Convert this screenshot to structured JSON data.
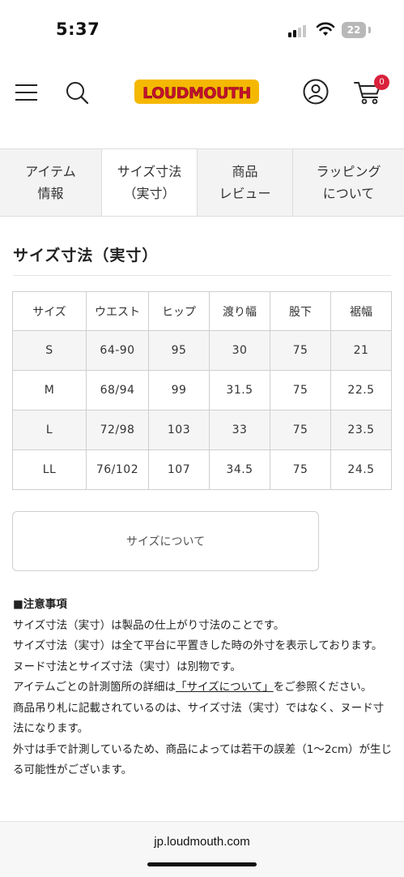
{
  "status_bar": {
    "time": "5:37",
    "battery": "22"
  },
  "header": {
    "logo_text": "LOUDMOUTH",
    "cart_count": "0"
  },
  "tabs": [
    {
      "label": "アイテム\n情報",
      "active": false
    },
    {
      "label": "サイズ寸法\n（実寸）",
      "active": true
    },
    {
      "label": "商品\nレビュー",
      "active": false
    },
    {
      "label": "ラッピング\nについて",
      "active": false
    }
  ],
  "section_title": "サイズ寸法（実寸）",
  "size_table": {
    "headers": [
      "サイズ",
      "ウエスト",
      "ヒップ",
      "渡り幅",
      "股下",
      "裾幅"
    ],
    "rows": [
      [
        "S",
        "64-90",
        "95",
        "30",
        "75",
        "21"
      ],
      [
        "M",
        "68/94",
        "99",
        "31.5",
        "75",
        "22.5"
      ],
      [
        "L",
        "72/98",
        "103",
        "33",
        "75",
        "23.5"
      ],
      [
        "LL",
        "76/102",
        "107",
        "34.5",
        "75",
        "24.5"
      ]
    ]
  },
  "about_size_button": "サイズについて",
  "notes": {
    "heading": "■注意事項",
    "line1": "サイズ寸法（実寸）は製品の仕上がり寸法のことです。",
    "line2": "サイズ寸法（実寸）は全て平台に平置きした時の外寸を表示しております。",
    "line3": "ヌード寸法とサイズ寸法（実寸）は別物です。",
    "line4_pre": "アイテムごとの計測箇所の詳細は",
    "line4_link": "「サイズについて」",
    "line4_post": "をご参照ください。",
    "line5": "商品吊り札に記載されているのは、サイズ寸法（実寸）ではなく、ヌード寸法になります。",
    "line6": "外寸は手で計測しているため、商品によっては若干の誤差（1〜2cm）が生じる可能性がございます。"
  },
  "browser": {
    "url": "jp.loudmouth.com"
  },
  "colors": {
    "accent": "#f5b800",
    "logo_red": "#c8102e",
    "badge": "#d9213b"
  }
}
